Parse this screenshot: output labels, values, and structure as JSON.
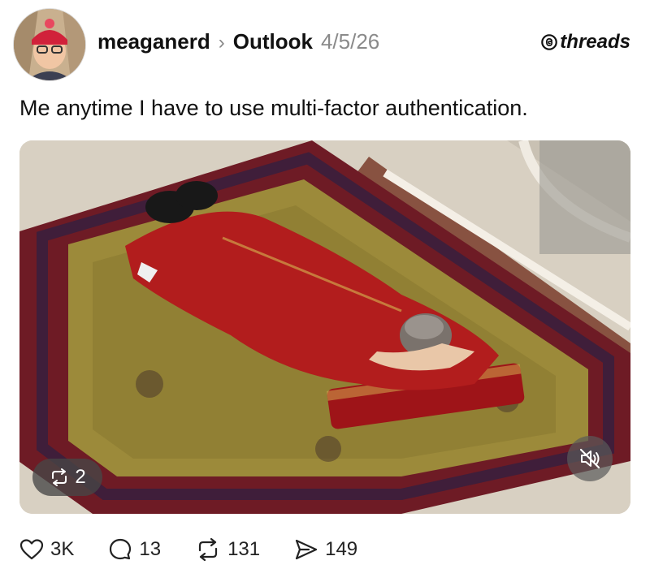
{
  "post": {
    "username": "meaganerd",
    "channel": "Outlook",
    "date": "4/5/26",
    "brand": "threads",
    "caption": "Me anytime I have to use multi-factor authentication."
  },
  "media": {
    "repost_count": "2",
    "mute_icon": "speaker-muted-icon"
  },
  "actions": {
    "likes": "3K",
    "comments": "13",
    "reposts": "131",
    "shares": "149"
  },
  "colors": {
    "robe_red": "#b21d1d",
    "carpet_maroon": "#6e1b25",
    "carpet_gold": "#9c8a3a",
    "floor_cream": "#e8e0d2"
  }
}
